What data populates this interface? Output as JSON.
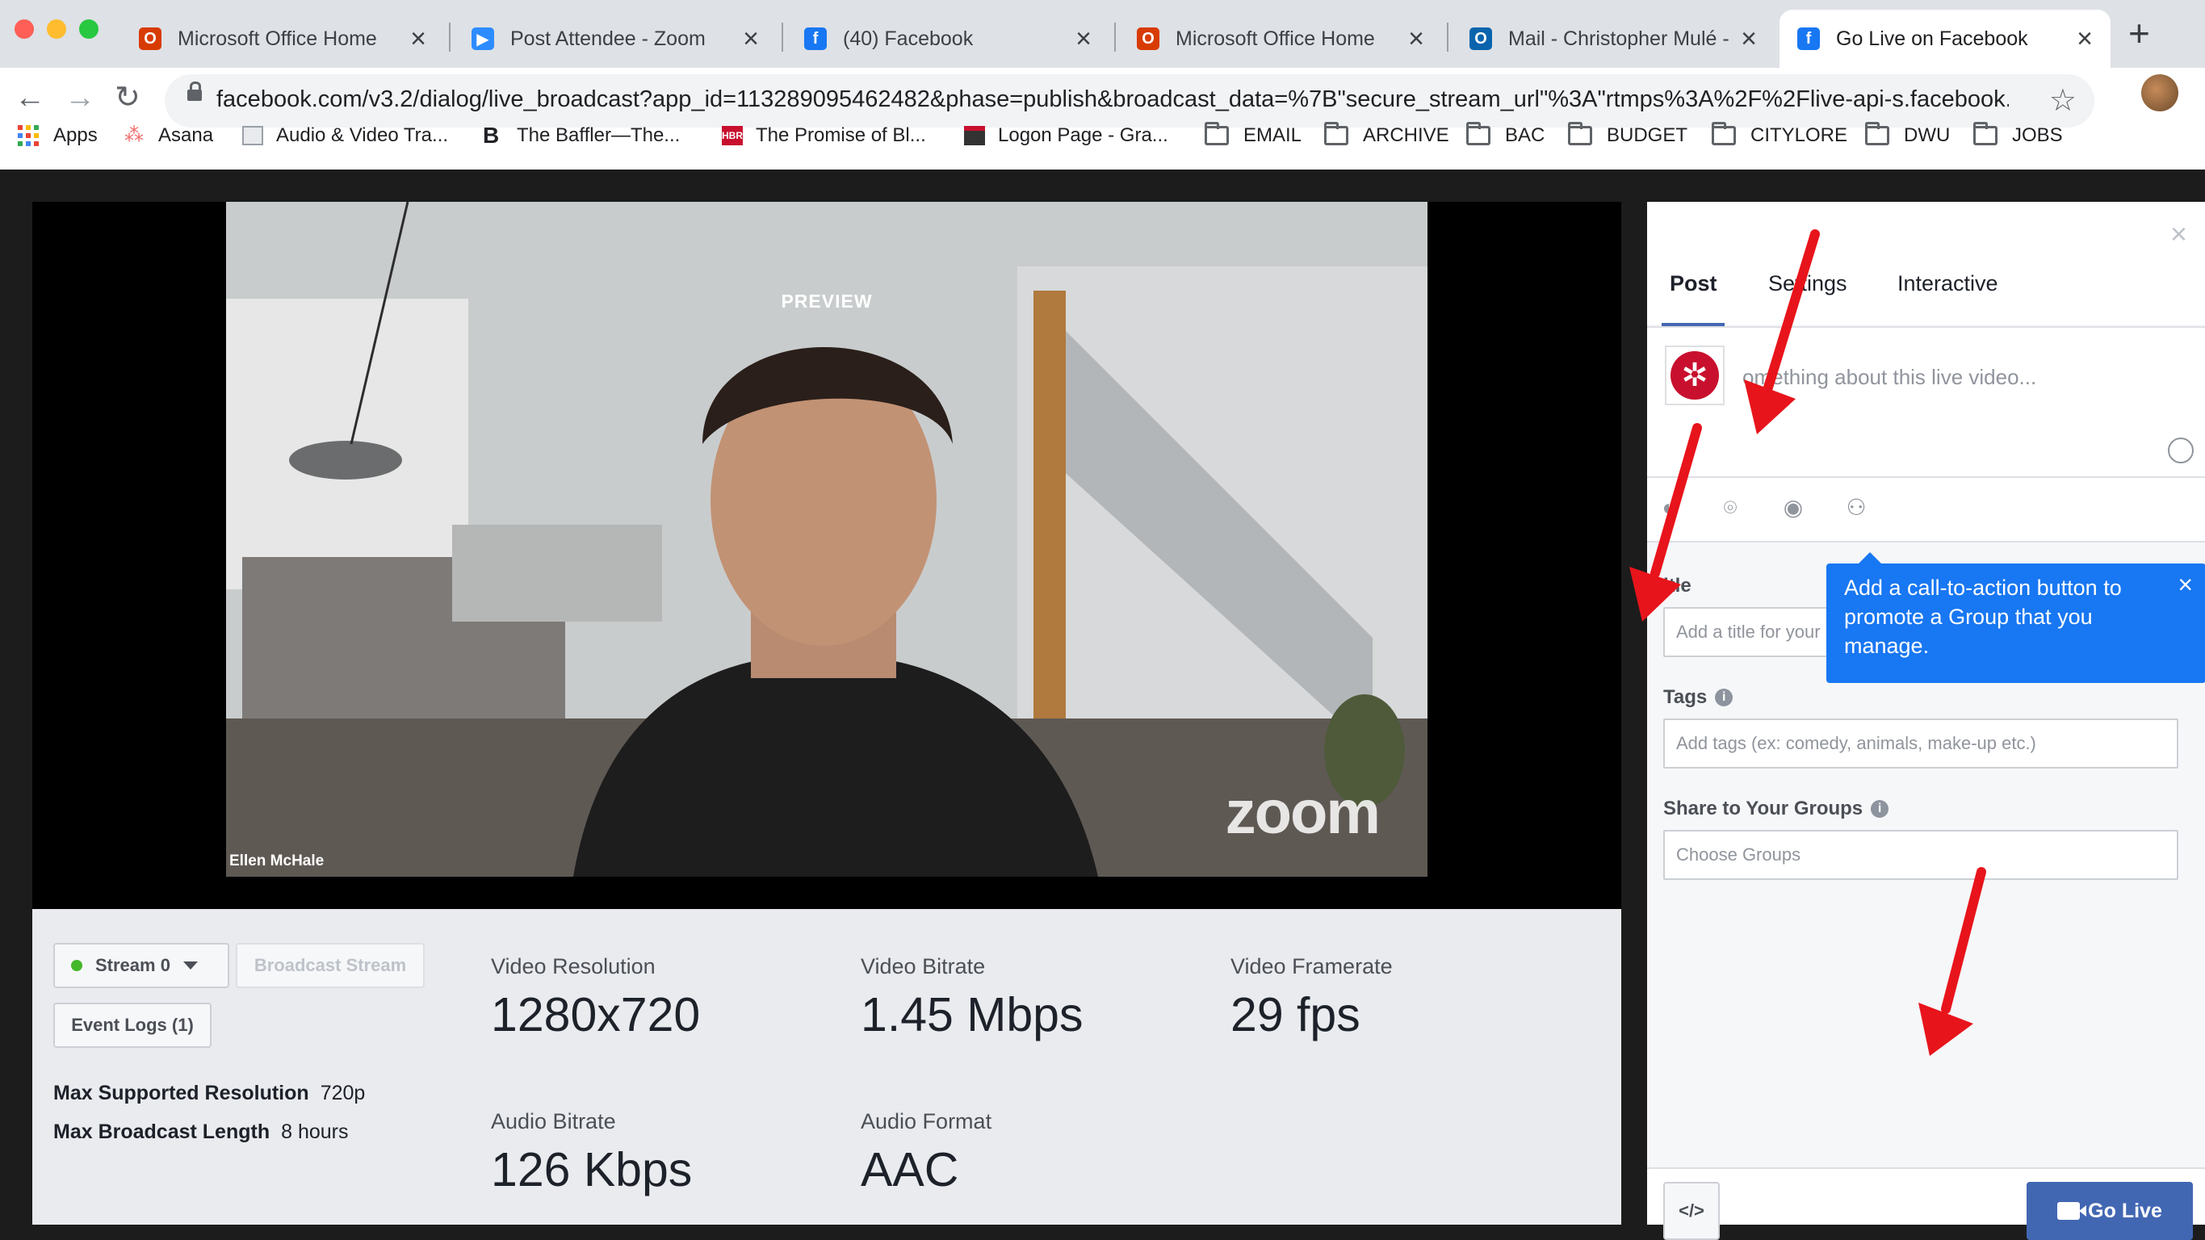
{
  "browser": {
    "tabs": [
      {
        "label": "Microsoft Office Home",
        "icon": "office-icon",
        "color": "#d83b01"
      },
      {
        "label": "Post Attendee - Zoom",
        "icon": "zoom-icon",
        "color": "#2d8cff"
      },
      {
        "label": "(40) Facebook",
        "icon": "facebook-icon",
        "color": "#1877f2"
      },
      {
        "label": "Microsoft Office Home",
        "icon": "office-icon",
        "color": "#d83b01"
      },
      {
        "label": "Mail - Christopher Mulé - (",
        "icon": "outlook-icon",
        "color": "#0a64ad"
      },
      {
        "label": "Go Live on Facebook",
        "icon": "facebook-icon",
        "color": "#1877f2"
      }
    ],
    "url": "facebook.com/v3.2/dialog/live_broadcast?app_id=113289095462482&phase=publish&broadcast_data=%7B\"secure_stream_url\"%3A\"rtmps%3A%2F%2Flive-api-s.facebook.com...",
    "bookmarks": [
      {
        "label": "Apps",
        "icon": "apps-grid-icon"
      },
      {
        "label": "Asana",
        "icon": "asana-icon"
      },
      {
        "label": "Audio & Video Tra...",
        "icon": "document-icon"
      },
      {
        "label": "The Baffler—The...",
        "icon": "baffler-icon"
      },
      {
        "label": "The Promise of Bl...",
        "icon": "hbr-icon"
      },
      {
        "label": "Logon Page - Gra...",
        "icon": "logon-icon"
      },
      {
        "label": "EMAIL",
        "icon": "folder-icon"
      },
      {
        "label": "ARCHIVE",
        "icon": "folder-icon"
      },
      {
        "label": "BAC",
        "icon": "folder-icon"
      },
      {
        "label": "BUDGET",
        "icon": "folder-icon"
      },
      {
        "label": "CITYLORE",
        "icon": "folder-icon"
      },
      {
        "label": "DWU",
        "icon": "folder-icon"
      },
      {
        "label": "JOBS",
        "icon": "folder-icon"
      }
    ]
  },
  "preview": {
    "label": "PREVIEW",
    "participant_name": "Ellen McHale",
    "watermark": "zoom"
  },
  "controls": {
    "stream_label": "Stream 0",
    "broadcast_label": "Broadcast Stream",
    "event_logs_label": "Event Logs (1)",
    "max_resolution_label": "Max Supported Resolution",
    "max_resolution_value": "720p",
    "max_length_label": "Max Broadcast Length",
    "max_length_value": "8 hours"
  },
  "stats": {
    "video_resolution_label": "Video Resolution",
    "video_resolution_value": "1280x720",
    "video_bitrate_label": "Video Bitrate",
    "video_bitrate_value": "1.45 Mbps",
    "video_framerate_label": "Video Framerate",
    "video_framerate_value": "29 fps",
    "audio_bitrate_label": "Audio Bitrate",
    "audio_bitrate_value": "126 Kbps",
    "audio_format_label": "Audio Format",
    "audio_format_value": "AAC"
  },
  "panel": {
    "tabs": [
      "Post",
      "Settings",
      "Interactive"
    ],
    "compose_placeholder": "omething about this live video...",
    "title_label": "itle",
    "title_placeholder": "Add a title for your",
    "tags_label": "Tags",
    "tags_placeholder": "Add tags (ex: comedy, animals, make-up etc.)",
    "groups_label": "Share to Your Groups",
    "groups_placeholder": "Choose Groups",
    "tooltip_text": "Add a call-to-action button to promote a Group that you manage.",
    "embed_label": "</>",
    "go_live_label": "Go Live"
  },
  "colors": {
    "accent": "#4267b2",
    "tooltip": "#1877f2",
    "annotation_arrow": "#e8141b",
    "live_dot": "#42b72a"
  }
}
